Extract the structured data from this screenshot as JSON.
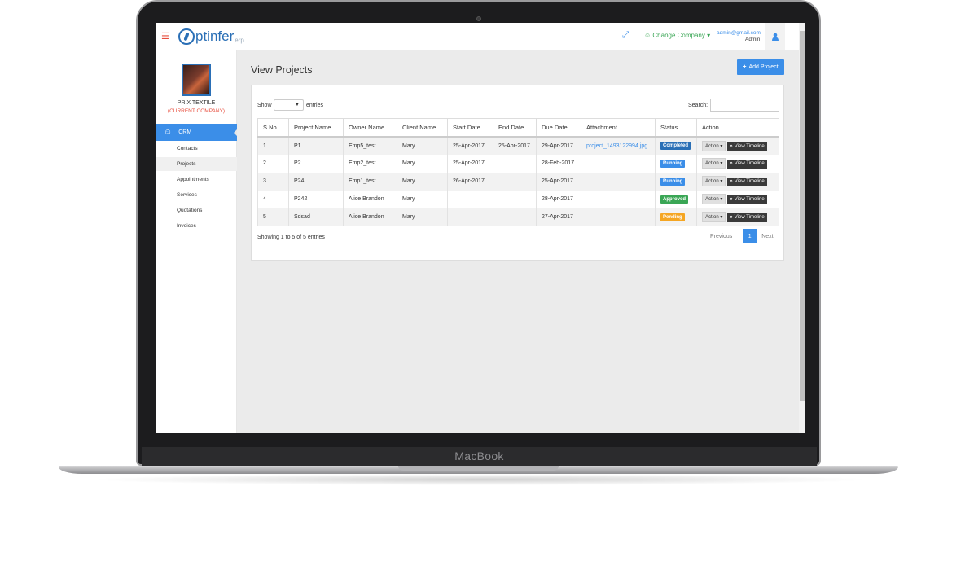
{
  "device": {
    "brand": "MacBook"
  },
  "topbar": {
    "logo_text": "ptinfer",
    "logo_sub": "erp",
    "change_company": "☺ Change Company ▾",
    "user_email": "admin@gmail.com",
    "user_role": "Admin"
  },
  "sidebar": {
    "company_name": "PRIX TEXTILE",
    "company_tag": "(CURRENT COMPANY)",
    "crm_label": "CRM",
    "items": [
      {
        "label": "Contacts"
      },
      {
        "label": "Projects"
      },
      {
        "label": "Appointments"
      },
      {
        "label": "Services"
      },
      {
        "label": "Quotations"
      },
      {
        "label": "Invoices"
      }
    ]
  },
  "main": {
    "title": "View Projects",
    "add_button": "Add Project",
    "show_label": "Show",
    "entries_label": "entries",
    "search_label": "Search:",
    "search_value": "",
    "columns": [
      "S No",
      "Project Name",
      "Owner Name",
      "Client Name",
      "Start Date",
      "End Date",
      "Due Date",
      "Attachment",
      "Status",
      "Action"
    ],
    "rows": [
      {
        "sno": "1",
        "project": "P1",
        "owner": "Emp5_test",
        "client": "Mary",
        "start": "25-Apr-2017",
        "end": "25-Apr-2017",
        "due": "29-Apr-2017",
        "attachment": "project_1493122994.jpg",
        "status": "Completed",
        "status_color": "#2a6fb6"
      },
      {
        "sno": "2",
        "project": "P2",
        "owner": "Emp2_test",
        "client": "Mary",
        "start": "25-Apr-2017",
        "end": "",
        "due": "28-Feb-2017",
        "attachment": "",
        "status": "Running",
        "status_color": "#3b8ee8"
      },
      {
        "sno": "3",
        "project": "P24",
        "owner": "Emp1_test",
        "client": "Mary",
        "start": "26-Apr-2017",
        "end": "",
        "due": "25-Apr-2017",
        "attachment": "",
        "status": "Running",
        "status_color": "#3b8ee8"
      },
      {
        "sno": "4",
        "project": "P242",
        "owner": "Alice Brandon",
        "client": "Mary",
        "start": "",
        "end": "",
        "due": "28-Apr-2017",
        "attachment": "",
        "status": "Approved",
        "status_color": "#3aa655"
      },
      {
        "sno": "5",
        "project": "Sdsad",
        "owner": "Alice Brandon",
        "client": "Mary",
        "start": "",
        "end": "",
        "due": "27-Apr-2017",
        "attachment": "",
        "status": "Pending",
        "status_color": "#f5a623"
      }
    ],
    "action_label": "Action",
    "timeline_label": "View Timeline",
    "info": "Showing 1 to 5 of 5 entries",
    "pagination": {
      "prev": "Previous",
      "page": "1",
      "next": "Next"
    }
  }
}
